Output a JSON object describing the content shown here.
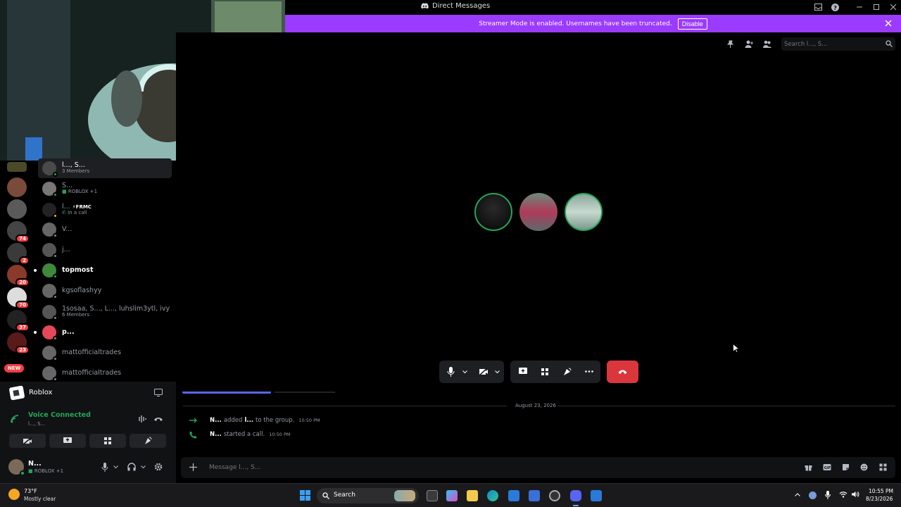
{
  "titlebar": {
    "title": "Direct Messages"
  },
  "banner": {
    "text": "Streamer Mode is enabled. Usernames have been truncated.",
    "button": "Disable"
  },
  "search": {
    "placeholder": "Search l..., S..."
  },
  "servers": [
    {
      "badge": ""
    },
    {
      "badge": ""
    },
    {
      "badge": ""
    },
    {
      "badge": "74"
    },
    {
      "badge": "2"
    },
    {
      "badge": "20"
    },
    {
      "badge": "70"
    },
    {
      "badge": "37"
    },
    {
      "badge": "23"
    },
    {
      "badge": "NEW"
    }
  ],
  "dms": [
    {
      "name": "l..., S...",
      "sub": "3 Members"
    },
    {
      "name": "S...",
      "sub": "ROBLOX +1"
    },
    {
      "name": "l...",
      "tag": "FRMC",
      "sub": "In a call"
    },
    {
      "name": "V...",
      "sub": ""
    },
    {
      "name": "j...",
      "sub": ""
    },
    {
      "name": "topmost",
      "sub": ""
    },
    {
      "name": "kgsoflashyy",
      "sub": ""
    },
    {
      "name": "1sosaa, S..., L..., luhslim3ytl, ivy",
      "sub": "6 Members"
    },
    {
      "name": "p...",
      "sub": ""
    },
    {
      "name": "mattofficialtrades",
      "sub": ""
    },
    {
      "name": "mattofficialtrades",
      "sub": ""
    }
  ],
  "activity": {
    "game": "Roblox"
  },
  "voice": {
    "status": "Voice Connected",
    "channel": "l..., S..."
  },
  "user": {
    "name": "N...",
    "status": "ROBLOX +1"
  },
  "chat": {
    "date": "August 23, 2026",
    "messages": [
      {
        "author": "N...",
        "action": "added",
        "target": "l...",
        "rest": "to the group.",
        "time": "10:50 PM"
      },
      {
        "author": "N...",
        "action": "started a call.",
        "target": "",
        "rest": "",
        "time": "10:50 PM"
      }
    ],
    "placeholder": "Message l..., S..."
  },
  "taskbar": {
    "weather_temp": "73°F",
    "weather_desc": "Mostly clear",
    "search": "Search",
    "time": "10:55 PM",
    "date": "8/23/2026"
  },
  "colors": {
    "banner": "#9b3bff",
    "end_call": "#da373c",
    "online": "#23a55a",
    "badge": "#f23f42",
    "voice_green": "#23a55a"
  }
}
